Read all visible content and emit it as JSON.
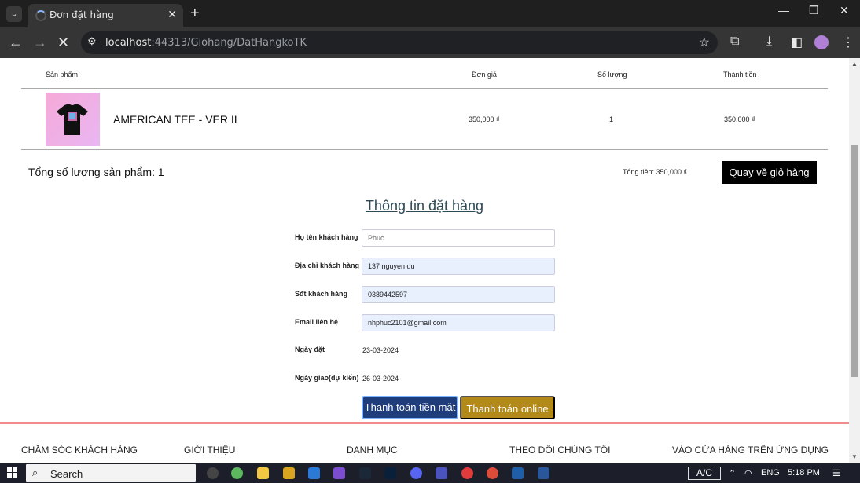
{
  "browser": {
    "tab_title": "Đơn đặt hàng",
    "url_host": "localhost",
    "url_path": ":44313/Giohang/DatHangkoTK"
  },
  "cart": {
    "headers": [
      "Sản phẩm",
      "Đơn giá",
      "Số lượng",
      "Thành tiền"
    ],
    "items": [
      {
        "name": "AMERICAN TEE - VER II",
        "price": "350,000 ₫",
        "qty": "1",
        "subtotal": "350,000 ₫"
      }
    ],
    "total_qty_label": "Tổng số lượng sản phẩm: 1",
    "total_money_label": "Tổng tiền: 350,000 ₫",
    "back_button": "Quay về giỏ hàng"
  },
  "form": {
    "title": "Thông tin đặt hàng",
    "name_label": "Họ tên khách hàng",
    "name_placeholder": "Phuc",
    "address_label": "Địa chỉ khách hàng",
    "address_value": "137 nguyen du",
    "phone_label": "Sđt khách hàng",
    "phone_value": "0389442597",
    "email_label": "Email liên hệ",
    "email_value": "nhphuc2101@gmail.com",
    "order_date_label": "Ngày đặt",
    "order_date_value": "23-03-2024",
    "delivery_date_label": "Ngày giao(dự kiến)",
    "delivery_date_value": "26-03-2024",
    "pay_cash": "Thanh toán tiền mặt",
    "pay_online": "Thanh toán online"
  },
  "footer": {
    "columns": [
      "CHĂM SÓC KHÁCH HÀNG",
      "GIỚI THIỆU",
      "DANH MỤC",
      "THEO DÕI CHÚNG TÔI",
      "VÀO CỬA HÀNG TRÊN ỨNG DỤNG"
    ]
  },
  "taskbar": {
    "search": "Search",
    "ac": "A/C",
    "lang": "ENG",
    "time": "5:18 PM"
  },
  "colors": {
    "title": "#2e4a56",
    "pay_cash_bg": "#1f3d7a",
    "pay_online_bg": "#b38a1a",
    "footer_accent": "#f08a8a"
  }
}
